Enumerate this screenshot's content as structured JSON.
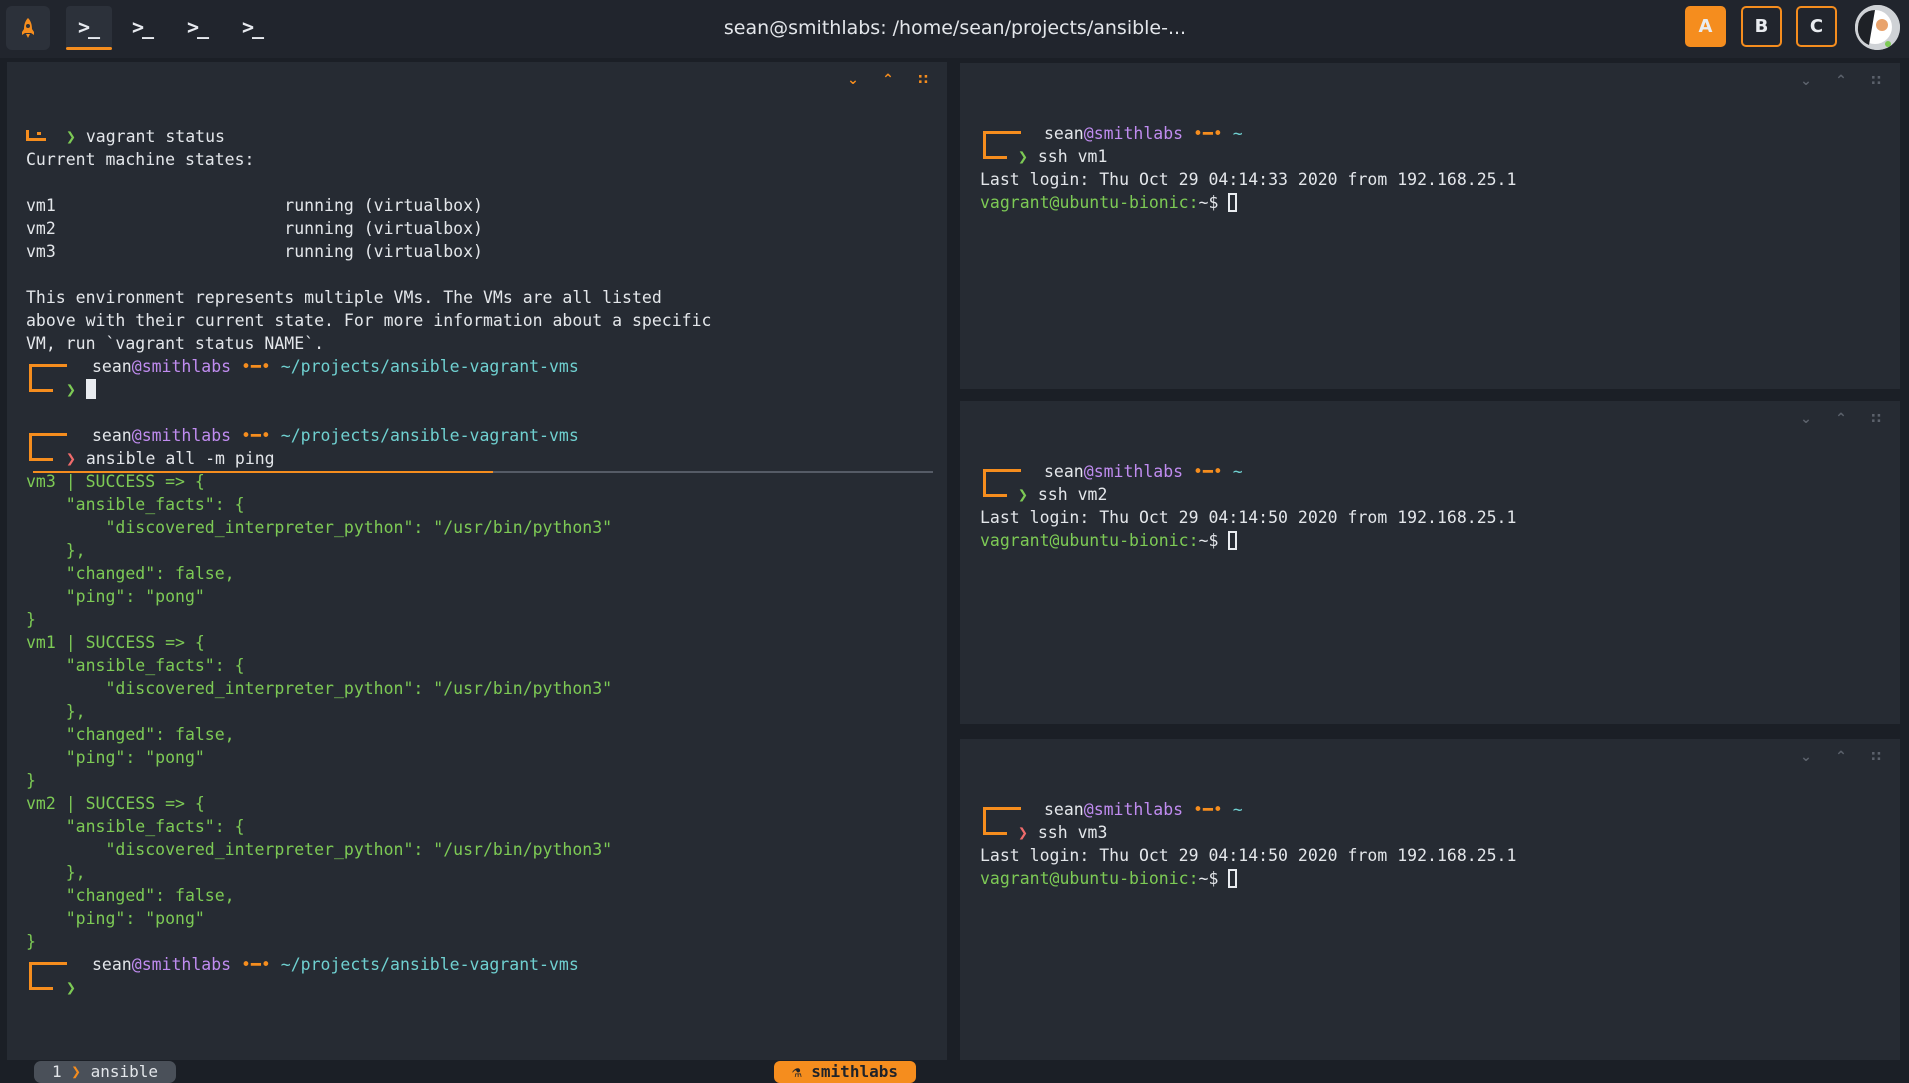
{
  "topbar": {
    "title": "sean@smithlabs: /home/sean/projects/ansible-...",
    "tab_glyph": ">_",
    "workspaces": [
      "A",
      "B",
      "C"
    ]
  },
  "colors": {
    "accent": "#f58d1e",
    "background": "#1b1f26",
    "pane": "#262b33",
    "green": "#7dca55",
    "purple": "#c08cf0"
  },
  "icons": {
    "app_logo": "rocket-icon",
    "pane_down": "chevron-down-icon",
    "pane_up": "chevron-up-icon",
    "pane_grid": "grid-icon"
  },
  "left_top": {
    "command": "vagrant status",
    "output": [
      "Current machine states:",
      "",
      "vm1                       running (virtualbox)",
      "vm2                       running (virtualbox)",
      "vm3                       running (virtualbox)",
      "",
      "This environment represents multiple VMs. The VMs are all listed",
      "above with their current state. For more information about a specific",
      "VM, run `vagrant status NAME`."
    ],
    "prompt_user": "sean",
    "prompt_at": "@",
    "prompt_host": "smithlabs",
    "prompt_sep": "•━•",
    "prompt_path": "~/projects/ansible-vagrant-vms"
  },
  "left_bottom": {
    "prompt_user": "sean",
    "prompt_at": "@",
    "prompt_host": "smithlabs",
    "prompt_sep": "•━•",
    "prompt_path": "~/projects/ansible-vagrant-vms",
    "command": "ansible all -m ping",
    "output": [
      "vm3 | SUCCESS => {",
      "    \"ansible_facts\": {",
      "        \"discovered_interpreter_python\": \"/usr/bin/python3\"",
      "    },",
      "    \"changed\": false,",
      "    \"ping\": \"pong\"",
      "}",
      "vm1 | SUCCESS => {",
      "    \"ansible_facts\": {",
      "        \"discovered_interpreter_python\": \"/usr/bin/python3\"",
      "    },",
      "    \"changed\": false,",
      "    \"ping\": \"pong\"",
      "}",
      "vm2 | SUCCESS => {",
      "    \"ansible_facts\": {",
      "        \"discovered_interpreter_python\": \"/usr/bin/python3\"",
      "    },",
      "    \"changed\": false,",
      "    \"ping\": \"pong\"",
      "}"
    ],
    "final_prompt_path": "~/projects/ansible-vagrant-vms"
  },
  "status_bar": {
    "window_index": "1",
    "window_name": "ansible",
    "host": "smithlabs"
  },
  "right_panes": [
    {
      "prompt_user": "sean",
      "prompt_at": "@",
      "prompt_host": "smithlabs",
      "prompt_sep": "•━•",
      "prompt_path": "~",
      "command": "ssh vm1",
      "last_login": "Last login: Thu Oct 29 04:14:33 2020 from 192.168.25.1",
      "shell_prompt": "vagrant@ubuntu-bionic:",
      "shell_suffix": "~$ "
    },
    {
      "prompt_user": "sean",
      "prompt_at": "@",
      "prompt_host": "smithlabs",
      "prompt_sep": "•━•",
      "prompt_path": "~",
      "command": "ssh vm2",
      "last_login": "Last login: Thu Oct 29 04:14:50 2020 from 192.168.25.1",
      "shell_prompt": "vagrant@ubuntu-bionic:",
      "shell_suffix": "~$ "
    },
    {
      "prompt_user": "sean",
      "prompt_at": "@",
      "prompt_host": "smithlabs",
      "prompt_sep": "•━•",
      "prompt_path": "~",
      "command": "ssh vm3",
      "last_login": "Last login: Thu Oct 29 04:14:50 2020 from 192.168.25.1",
      "shell_prompt": "vagrant@ubuntu-bionic:",
      "shell_suffix": "~$ "
    }
  ]
}
